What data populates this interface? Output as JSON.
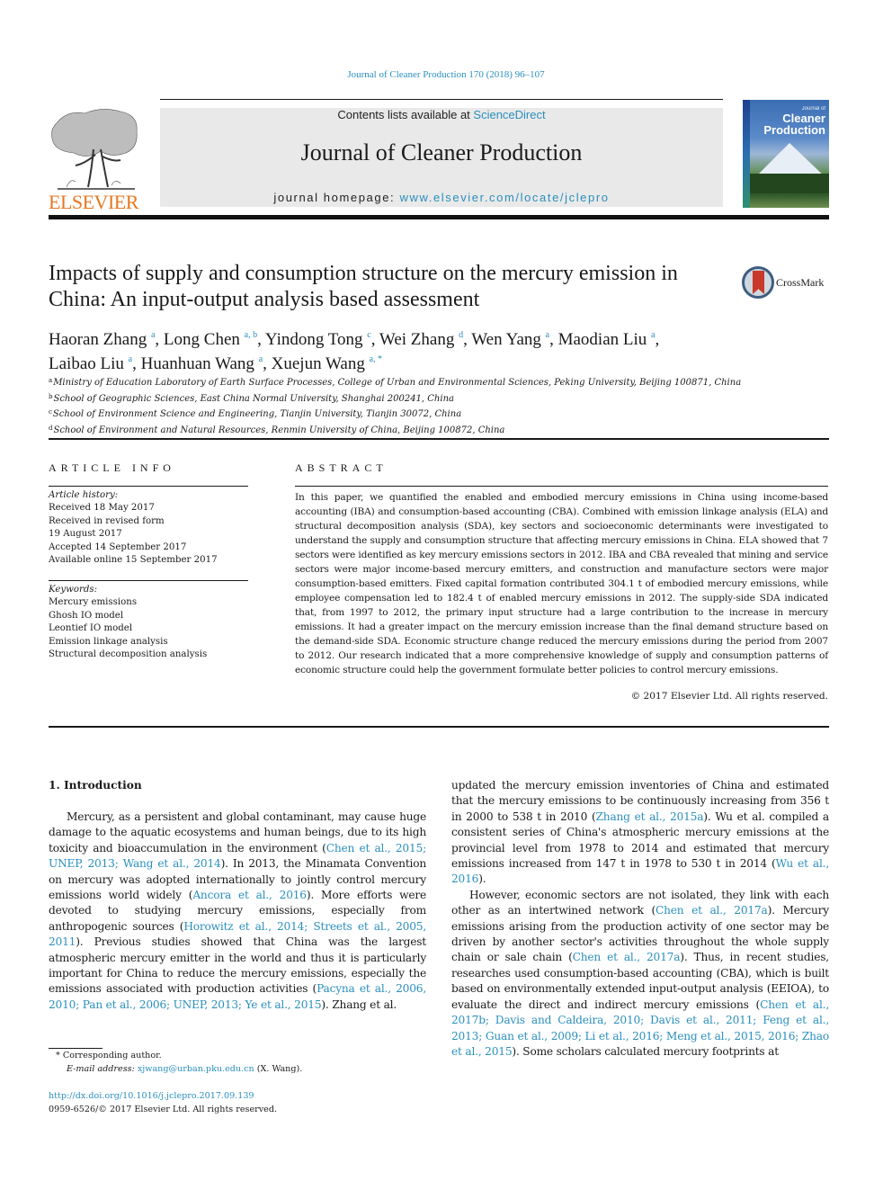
{
  "header": {
    "citation": "Journal of Cleaner Production 170 (2018) 96–107",
    "contents_prefix": "Contents lists available at ",
    "contents_link": "ScienceDirect",
    "journal_name": "Journal of Cleaner Production",
    "homepage_prefix": "journal homepage: ",
    "homepage_link": "www.elsevier.com/locate/jclepro",
    "publisher_logo_text": "ELSEVIER",
    "cover": {
      "line1": "Journal of",
      "line2": "Cleaner",
      "line3": "Production"
    }
  },
  "article": {
    "title": "Impacts of supply and consumption structure on the mercury emission in China: An input-output analysis based assessment",
    "crossmark_label": "CrossMark",
    "authors": [
      {
        "name": "Haoran Zhang",
        "aff": "a",
        "sep": ", "
      },
      {
        "name": "Long Chen",
        "aff": "a, b",
        "sep": ", "
      },
      {
        "name": "Yindong Tong",
        "aff": "c",
        "sep": ", "
      },
      {
        "name": "Wei Zhang",
        "aff": "d",
        "sep": ", "
      },
      {
        "name": "Wen Yang",
        "aff": "a",
        "sep": ", "
      },
      {
        "name": "Maodian Liu",
        "aff": "a",
        "sep": ","
      },
      {
        "name": "Laibao Liu",
        "aff": "a",
        "sep": ", "
      },
      {
        "name": "Huanhuan Wang",
        "aff": "a",
        "sep": ", "
      },
      {
        "name": "Xuejun Wang",
        "aff": "a, *",
        "sep": ""
      }
    ],
    "affiliations": [
      {
        "key": "a",
        "text": "Ministry of Education Laboratory of Earth Surface Processes, College of Urban and Environmental Sciences, Peking University, Beijing 100871, China"
      },
      {
        "key": "b",
        "text": "School of Geographic Sciences, East China Normal University, Shanghai 200241, China"
      },
      {
        "key": "c",
        "text": "School of Environment Science and Engineering, Tianjin University, Tianjin 30072, China"
      },
      {
        "key": "d",
        "text": "School of Environment and Natural Resources, Renmin University of China, Beijing 100872, China"
      }
    ]
  },
  "article_info": {
    "heading": "ARTICLE INFO",
    "history_label": "Article history:",
    "history": [
      "Received 18 May 2017",
      "Received in revised form",
      "19 August 2017",
      "Accepted 14 September 2017",
      "Available online 15 September 2017"
    ],
    "keywords_label": "Keywords:",
    "keywords": [
      "Mercury emissions",
      "Ghosh IO model",
      "Leontief IO model",
      "Emission linkage analysis",
      "Structural decomposition analysis"
    ]
  },
  "abstract": {
    "heading": "ABSTRACT",
    "text": "In this paper, we quantified the enabled and embodied mercury emissions in China using income-based accounting (IBA) and consumption-based accounting (CBA). Combined with emission linkage analysis (ELA) and structural decomposition analysis (SDA), key sectors and socioeconomic determinants were investigated to understand the supply and consumption structure that affecting mercury emissions in China. ELA showed that 7 sectors were identified as key mercury emissions sectors in 2012. IBA and CBA revealed that mining and service sectors were major income-based mercury emitters, and construction and manufacture sectors were major consumption-based emitters. Fixed capital formation contributed 304.1 t of embodied mercury emissions, while employee compensation led to 182.4 t of enabled mercury emissions in 2012. The supply-side SDA indicated that, from 1997 to 2012, the primary input structure had a large contribution to the increase in mercury emissions. It had a greater impact on the mercury emission increase than the final demand structure based on the demand-side SDA. Economic structure change reduced the mercury emissions during the period from 2007 to 2012. Our research indicated that a more comprehensive knowledge of supply and consumption patterns of economic structure could help the government formulate better policies to control mercury emissions.",
    "copyright": "© 2017 Elsevier Ltd. All rights reserved."
  },
  "body": {
    "section_heading": "1.  Introduction",
    "left_paragraph": [
      {
        "t": "Mercury, as a persistent and global contaminant, may cause huge damage to the aquatic ecosystems and human beings, due to its high toxicity and bioaccumulation in the environment ("
      },
      {
        "l": "Chen et al., 2015; UNEP, 2013; Wang et al., 2014"
      },
      {
        "t": "). In 2013, the Mina­mata Convention on mercury was adopted internationally to jointly control mercury emissions world widely ("
      },
      {
        "l": "Ancora et al., 2016"
      },
      {
        "t": "). More efforts were devoted to studying mercury emissions, especially from anthropogenic sources ("
      },
      {
        "l": "Horowitz et al., 2014; Streets et al., 2005, 2011"
      },
      {
        "t": "). Previous studies showed that China was the largest atmospheric mercury emitter in the world and thus it is particularly important for China to reduce the mercury emissions, especially the emissions associated with production activities ("
      },
      {
        "l": "Pacyna et al., 2006, 2010; Pan et al., 2006; UNEP, 2013; Ye et al., 2015"
      },
      {
        "t": "). Zhang et al."
      }
    ],
    "right_paragraph_1": [
      {
        "t": "updated the mercury emission inventories of China and estimated that the mercury emissions to be continuously increasing from 356 t in 2000 to 538 t in 2010 ("
      },
      {
        "l": "Zhang et al., 2015a"
      },
      {
        "t": "). Wu et al. compiled a consistent series of China's atmospheric mercury emissions at the provincial level from 1978 to 2014 and estimated that mercury emissions increased from 147 t in 1978 to 530 t in 2014 ("
      },
      {
        "l": "Wu et al., 2016"
      },
      {
        "t": ")."
      }
    ],
    "right_paragraph_2": [
      {
        "t": "However, economic sectors are not isolated, they link with each other as an intertwined network ("
      },
      {
        "l": "Chen et al., 2017a"
      },
      {
        "t": "). Mercury emissions arising from the production activity of one sector may be driven by another sector's activities throughout the whole supply chain or sale chain ("
      },
      {
        "l": "Chen et al., 2017a"
      },
      {
        "t": "). Thus, in recent studies, researches used consumption-based accounting (CBA), which is built based on environmentally extended input-output analysis (EEIOA), to evaluate the direct and indirect mercury emissions ("
      },
      {
        "l": "Chen et al., 2017b; Davis and Caldeira, 2010; Davis et al., 2011; Feng et al., 2013; Guan et al., 2009; Li et al., 2016; Meng et al., 2015, 2016; Zhao et al., 2015"
      },
      {
        "t": "). Some scholars calculated mercury footprints at"
      }
    ]
  },
  "footnotes": {
    "corresponding_mark": "*",
    "corresponding_text": "Corresponding author.",
    "email_label": "E-mail address:",
    "email": "xjwang@urban.pku.edu.cn",
    "email_suffix": " (X. Wang).",
    "doi": "http://dx.doi.org/10.1016/j.jclepro.2017.09.139",
    "issn_copyright": "0959-6526/© 2017 Elsevier Ltd. All rights reserved."
  },
  "colors": {
    "link": "#2a8fbd",
    "elsevier_orange": "#e87722",
    "banner_gray": "#e9e9e9"
  }
}
